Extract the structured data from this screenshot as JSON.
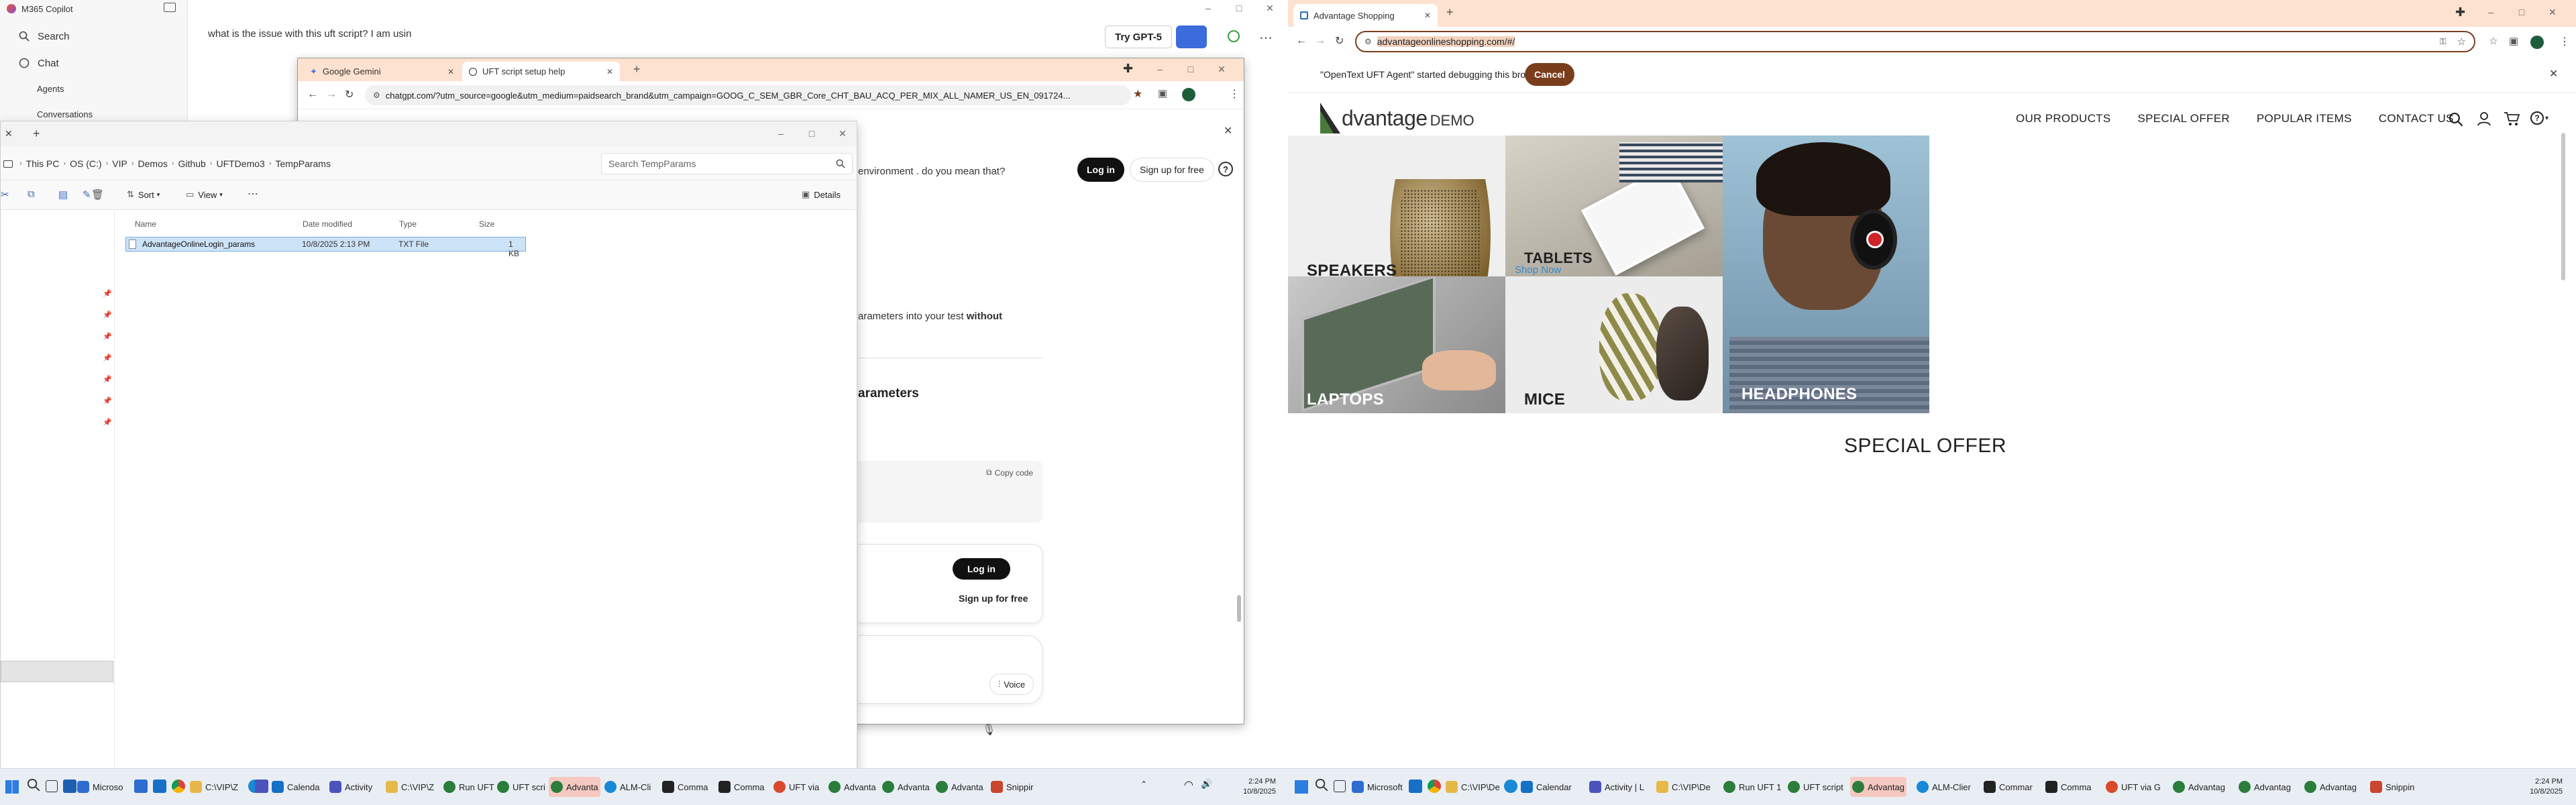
{
  "copilot": {
    "app_title": "M365 Copilot",
    "search": "Search",
    "chat": "Chat",
    "agents": "Agents",
    "conversations": "Conversations",
    "prompt": "what is the issue with this uft script? I am usin",
    "try_button": "Try GPT-5"
  },
  "chatgpt_window": {
    "tabs": [
      {
        "label": "Google Gemini"
      },
      {
        "label": "UFT script setup help"
      }
    ],
    "url": "chatgpt.com/?utm_source=google&utm_medium=paidsearch_brand&utm_campaign=GOOG_C_SEM_GBR_Core_CHT_BAU_ACQ_PER_MIX_ALL_NAMER_US_EN_091724...",
    "text_environment": "environment . do you mean that?",
    "login": "Log in",
    "signup": "Sign up for free",
    "text_parameters_pre": "arameters into your test ",
    "text_without": "without",
    "heading": "arameters",
    "copy_code": "Copy code",
    "login2": "Log in",
    "signup2": "Sign up for free",
    "voice": "Voice"
  },
  "explorer": {
    "breadcrumbs": [
      "This PC",
      "OS (C:)",
      "VIP",
      "Demos",
      "Github",
      "UFTDemo3",
      "TempParams"
    ],
    "search_placeholder": "Search TempParams",
    "sort": "Sort",
    "view": "View",
    "details": "Details",
    "columns": [
      "Name",
      "Date modified",
      "Type",
      "Size"
    ],
    "files": [
      {
        "name": "AdvantageOnlineLogin_params",
        "date": "10/8/2025 2:13 PM",
        "type": "TXT File",
        "size": "1 KB"
      }
    ]
  },
  "taskbar1": {
    "items": [
      "Microso",
      "C:\\VIP\\Z",
      "Calenda",
      "Activity",
      "C:\\VIP\\Z",
      "Run UFT",
      "UFT scri",
      "Advanta",
      "ALM-Cli",
      "Comma",
      "Comma",
      "UFT via",
      "Advanta",
      "Advanta",
      "Advanta",
      "Snippir"
    ],
    "time": "2:24 PM",
    "date": "10/8/2025"
  },
  "browser2": {
    "tab": "Advantage Shopping",
    "url": "advantageonlineshopping.com/#/",
    "debug_message": "\"OpenText UFT Agent\" started debugging this browser",
    "cancel": "Cancel"
  },
  "site": {
    "logo_main": "dvantage",
    "logo_sub": "DEMO",
    "nav": [
      "OUR PRODUCTS",
      "SPECIAL OFFER",
      "POPULAR ITEMS",
      "CONTACT US"
    ],
    "categories": {
      "speakers": "SPEAKERS",
      "tablets": "TABLETS",
      "shop_now": "Shop Now",
      "laptops": "LAPTOPS",
      "mice": "MICE",
      "headphones": "HEADPHONES"
    },
    "special_offer": "SPECIAL OFFER"
  },
  "taskbar2": {
    "items": [
      "Microsoft",
      "C:\\VIP\\De",
      "Calendar",
      "Activity | L",
      "C:\\VIP\\De",
      "Run UFT 1",
      "UFT script",
      "Advantag",
      "ALM-Clier",
      "Commar",
      "Comma",
      "UFT via G",
      "Advantag",
      "Advantag",
      "Advantag",
      "Snippin"
    ],
    "time": "2:24 PM",
    "date": "10/8/2025"
  },
  "colors": {
    "accent_orange": "#7a3d1c",
    "brand_green": "#4a7a3a",
    "tab_strip": "#fde2cf",
    "active_task": "#f5c9c1"
  }
}
